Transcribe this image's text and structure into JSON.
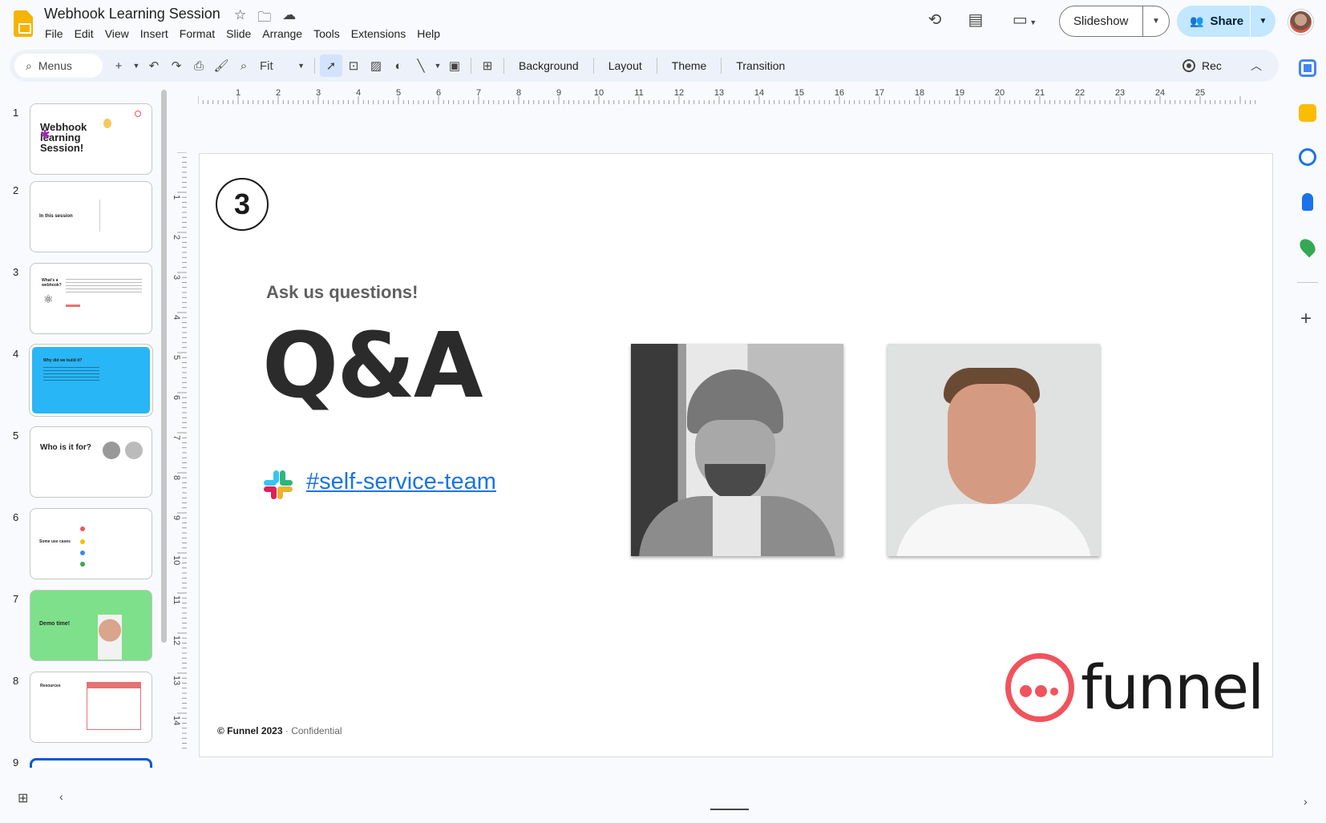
{
  "app": {
    "title": "Webhook Learning Session",
    "menu": [
      "File",
      "Edit",
      "View",
      "Insert",
      "Format",
      "Slide",
      "Arrange",
      "Tools",
      "Extensions",
      "Help"
    ]
  },
  "header": {
    "slideshow_label": "Slideshow",
    "share_label": "Share"
  },
  "toolbar": {
    "search_label": "Menus",
    "zoom_label": "Fit",
    "background_label": "Background",
    "layout_label": "Layout",
    "theme_label": "Theme",
    "transition_label": "Transition",
    "rec_label": "Rec"
  },
  "ruler": {
    "h_ticks": [
      "1",
      "2",
      "3",
      "4",
      "5",
      "6",
      "7",
      "8",
      "9",
      "10",
      "11",
      "12",
      "13",
      "14",
      "15",
      "16",
      "17",
      "18",
      "19",
      "20",
      "21",
      "22",
      "23",
      "24",
      "25"
    ],
    "v_ticks": [
      "1",
      "2",
      "3",
      "4",
      "5",
      "6",
      "7",
      "8",
      "9",
      "10",
      "11",
      "12",
      "13",
      "14"
    ]
  },
  "filmstrip": {
    "numbers": [
      "1",
      "2",
      "3",
      "4",
      "5",
      "6",
      "7",
      "8",
      "9"
    ],
    "slide1_title": "Webhook learning Session!",
    "slide2_title": "In this session",
    "slide3_title": "What's a webhook?",
    "slide4_title": "Why did we build it?",
    "slide5_title": "Who is it for?",
    "slide6_title": "Some use cases",
    "slide7_title": "Demo time!",
    "slide8_title": "Resources"
  },
  "slide": {
    "number": "3",
    "subtitle": "Ask us questions!",
    "title": "Q&A",
    "channel": "#self-service-team",
    "footer_company": "© Funnel 2023",
    "footer_conf": " · Confidential",
    "logo_word": "funnel"
  },
  "colors": {
    "accent": "#f0535e",
    "link": "#1a73e8",
    "share_bg": "#c2e7ff",
    "slide4_bg": "#29b6f6",
    "slide7_bg": "#7ee08a"
  }
}
